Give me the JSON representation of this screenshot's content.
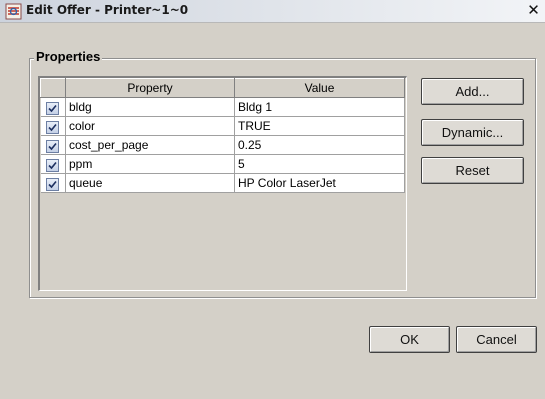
{
  "window": {
    "title": "Edit Offer - Printer~1~0",
    "close_label": "✕"
  },
  "properties": {
    "group_label": "Properties",
    "columns": {
      "property": "Property",
      "value": "Value"
    },
    "rows": [
      {
        "checked": true,
        "property": "bldg",
        "value": "Bldg 1"
      },
      {
        "checked": true,
        "property": "color",
        "value": "TRUE"
      },
      {
        "checked": true,
        "property": "cost_per_page",
        "value": "0.25"
      },
      {
        "checked": true,
        "property": "ppm",
        "value": "5"
      },
      {
        "checked": true,
        "property": "queue",
        "value": "HP Color LaserJet"
      }
    ]
  },
  "buttons": {
    "add": "Add...",
    "dynamic": "Dynamic...",
    "reset": "Reset",
    "ok": "OK",
    "cancel": "Cancel"
  },
  "colors": {
    "titlebar": "#e0e4ea",
    "dialog": "#d4d0c8",
    "checkbox_border": "#6d7fa3"
  }
}
